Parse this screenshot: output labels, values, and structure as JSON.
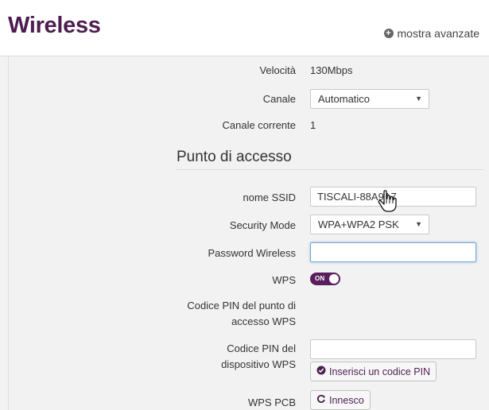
{
  "header": {
    "title": "Wireless",
    "advanced_label": "mostra avanzate",
    "advanced_icon": "plus-circle-icon"
  },
  "radio": {
    "speed_label": "Velocità",
    "speed_value": "130Mbps",
    "channel_label": "Canale",
    "channel_selected": "Automatico",
    "current_channel_label": "Canale corrente",
    "current_channel_value": "1"
  },
  "access_point": {
    "section_title": "Punto di accesso",
    "ssid_label": "nome SSID",
    "ssid_value": "TISCALI-88A9A7",
    "security_label": "Security Mode",
    "security_selected": "WPA+WPA2 PSK",
    "password_label": "Password Wireless",
    "password_value": "",
    "wps_label": "WPS",
    "wps_toggle_text": "ON",
    "ap_pin_label_1": "Codice PIN del punto di",
    "ap_pin_label_2": "accesso WPS",
    "device_pin_label_1": "Codice PIN del",
    "device_pin_label_2": "dispositivo WPS",
    "device_pin_value": "",
    "insert_pin_button": "Inserisci un codice PIN",
    "insert_pin_icon": "check-circle-icon",
    "wps_pcb_label": "WPS PCB",
    "trigger_button": "Innesco",
    "trigger_icon": "refresh-icon"
  },
  "colors": {
    "brand": "#4d1d50",
    "toggle_on": "#5a1d5e",
    "panel_bg": "#f2f2f2",
    "focus_border": "#73a9d8"
  }
}
